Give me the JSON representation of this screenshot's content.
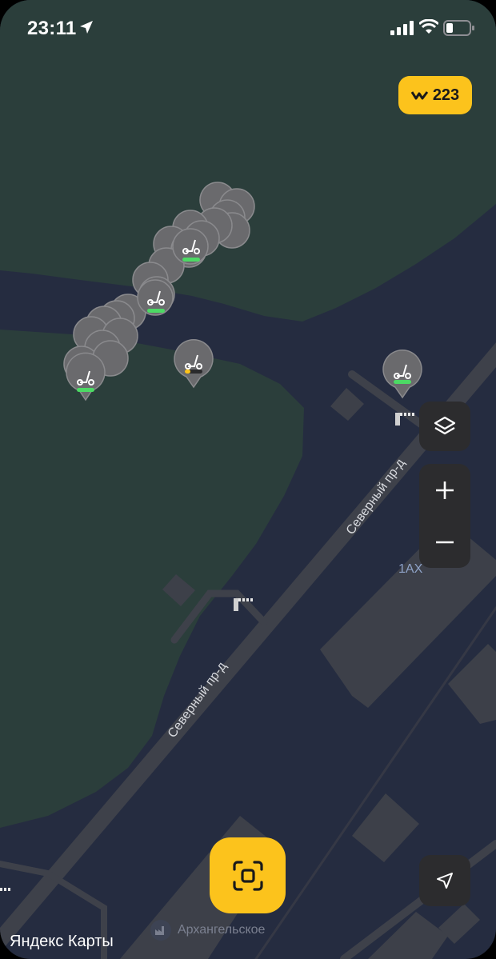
{
  "status_bar": {
    "time": "23:11",
    "icons": [
      "location-arrow-icon",
      "cellular-signal-icon",
      "wifi-icon",
      "battery-icon"
    ]
  },
  "balance": {
    "icon": "whoosh-logo-icon",
    "value": "w 223",
    "amount": "223"
  },
  "map": {
    "streets": [
      {
        "name": "Северный пр-д"
      },
      {
        "name": "Северный пр-д"
      }
    ],
    "house_number": "1АХ",
    "district": "Архангельское",
    "colors": {
      "water": "#252c40",
      "park": "#2b3e3b",
      "road": "#3c3f48",
      "building": "#3d4049",
      "accent": "#fcc31c"
    }
  },
  "scooter_pins": [
    {
      "id": "cluster-main",
      "charge": "high"
    },
    {
      "id": "single-near-cluster",
      "charge": "low"
    },
    {
      "id": "single-right",
      "charge": "high"
    }
  ],
  "controls": {
    "layers": "layers-icon",
    "zoom_in": "+",
    "zoom_out": "−",
    "locate": "navigation-arrow-icon",
    "scan": "qr-scan-icon"
  },
  "brand": "Яндекс Карты"
}
